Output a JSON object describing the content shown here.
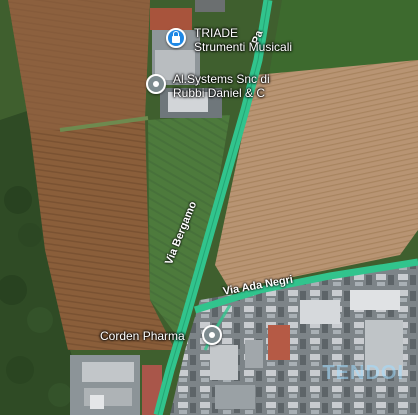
{
  "places": [
    {
      "name": "TRIADE\nStrumenti Musicali",
      "line1": "TRIADE",
      "line2": "Strumenti Musicali",
      "icon": "lock-icon",
      "color": "#1e88e5"
    },
    {
      "line1": "Al.Systems Snc di",
      "line2": "Rubbi Daniel & C",
      "icon": "location-pin-icon",
      "color": "#7d8b8f"
    },
    {
      "line1": "Corden Pharma",
      "icon": "location-pin-icon",
      "color": "#7d8b8f"
    }
  ],
  "roads": {
    "via_bergamo": "Via Bergamo",
    "via_ada_negri": "Via Ada Negri",
    "fragment_top": "Pa"
  },
  "colors": {
    "road": "#31c48d",
    "field_brown": "#8a5e3a",
    "field_tan": "#b89473",
    "grass": "#4d7a3c"
  },
  "watermark": "TENDOI"
}
